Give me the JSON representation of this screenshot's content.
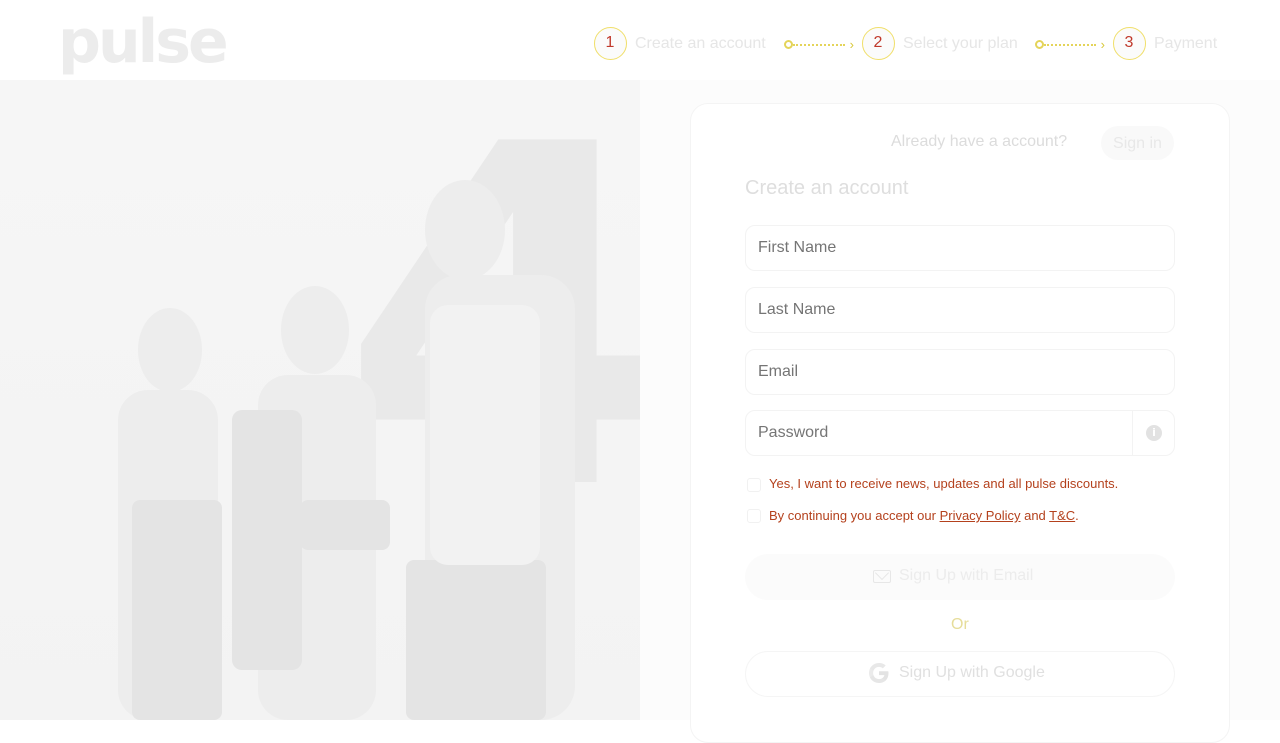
{
  "brand": {
    "logo_text": "pulse"
  },
  "stepper": {
    "steps": [
      {
        "number": "1",
        "label": "Create an account"
      },
      {
        "number": "2",
        "label": "Select your plan"
      },
      {
        "number": "3",
        "label": "Payment"
      }
    ]
  },
  "hero": {
    "big_number": "4"
  },
  "auth": {
    "already_text": "Already have a account?",
    "signin_label": "Sign in",
    "form_title": "Create an account"
  },
  "form": {
    "first_name_placeholder": "First Name",
    "last_name_placeholder": "Last Name",
    "email_placeholder": "Email",
    "password_placeholder": "Password",
    "info_glyph": "i",
    "newsletter_label": "Yes, I want to receive news, updates and all pulse discounts.",
    "terms_prefix": "By continuing you accept our ",
    "privacy_link": "Privacy Policy",
    "terms_and": " and ",
    "tc_link": "T&C",
    "terms_suffix": ".",
    "email_button_label": "Sign Up with Email",
    "or_label": "Or",
    "google_button_label": "Sign Up with Google"
  },
  "colors": {
    "accent_yellow": "#f0df6a",
    "step_number_red": "#c0392b",
    "consent_text": "#b4411d"
  },
  "icons": {
    "info": "info-circle-icon",
    "mail": "mail-icon",
    "google": "google-icon",
    "arrow": "arrow-right-icon"
  }
}
